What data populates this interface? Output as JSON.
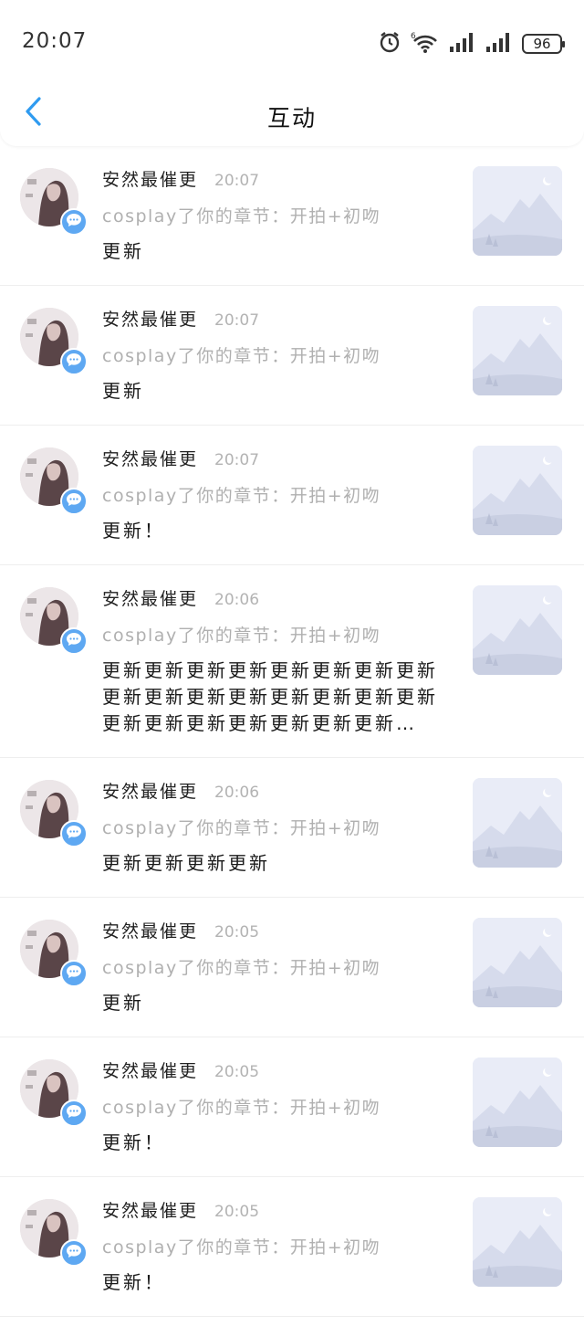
{
  "status_bar": {
    "time": "20:07",
    "battery": "96"
  },
  "header": {
    "title": "互动",
    "back_icon": "chevron-left-icon"
  },
  "colors": {
    "accent": "#2f9bf0",
    "badge": "#5ea8f2",
    "muted": "#b0b0b0"
  },
  "items": [
    {
      "user": "安然最催更",
      "time": "20:07",
      "action": "cosplay了你的章节：开拍+初吻",
      "comment": "更新"
    },
    {
      "user": "安然最催更",
      "time": "20:07",
      "action": "cosplay了你的章节：开拍+初吻",
      "comment": "更新"
    },
    {
      "user": "安然最催更",
      "time": "20:07",
      "action": "cosplay了你的章节：开拍+初吻",
      "comment": "更新！"
    },
    {
      "user": "安然最催更",
      "time": "20:06",
      "action": "cosplay了你的章节：开拍+初吻",
      "comment": "更新更新更新更新更新更新更新更新更新更新更新更新更新更新更新更新更新更新更新更新更新更新更新…"
    },
    {
      "user": "安然最催更",
      "time": "20:06",
      "action": "cosplay了你的章节：开拍+初吻",
      "comment": "更新更新更新更新"
    },
    {
      "user": "安然最催更",
      "time": "20:05",
      "action": "cosplay了你的章节：开拍+初吻",
      "comment": "更新"
    },
    {
      "user": "安然最催更",
      "time": "20:05",
      "action": "cosplay了你的章节：开拍+初吻",
      "comment": "更新！"
    },
    {
      "user": "安然最催更",
      "time": "20:05",
      "action": "cosplay了你的章节：开拍+初吻",
      "comment": "更新！"
    }
  ]
}
